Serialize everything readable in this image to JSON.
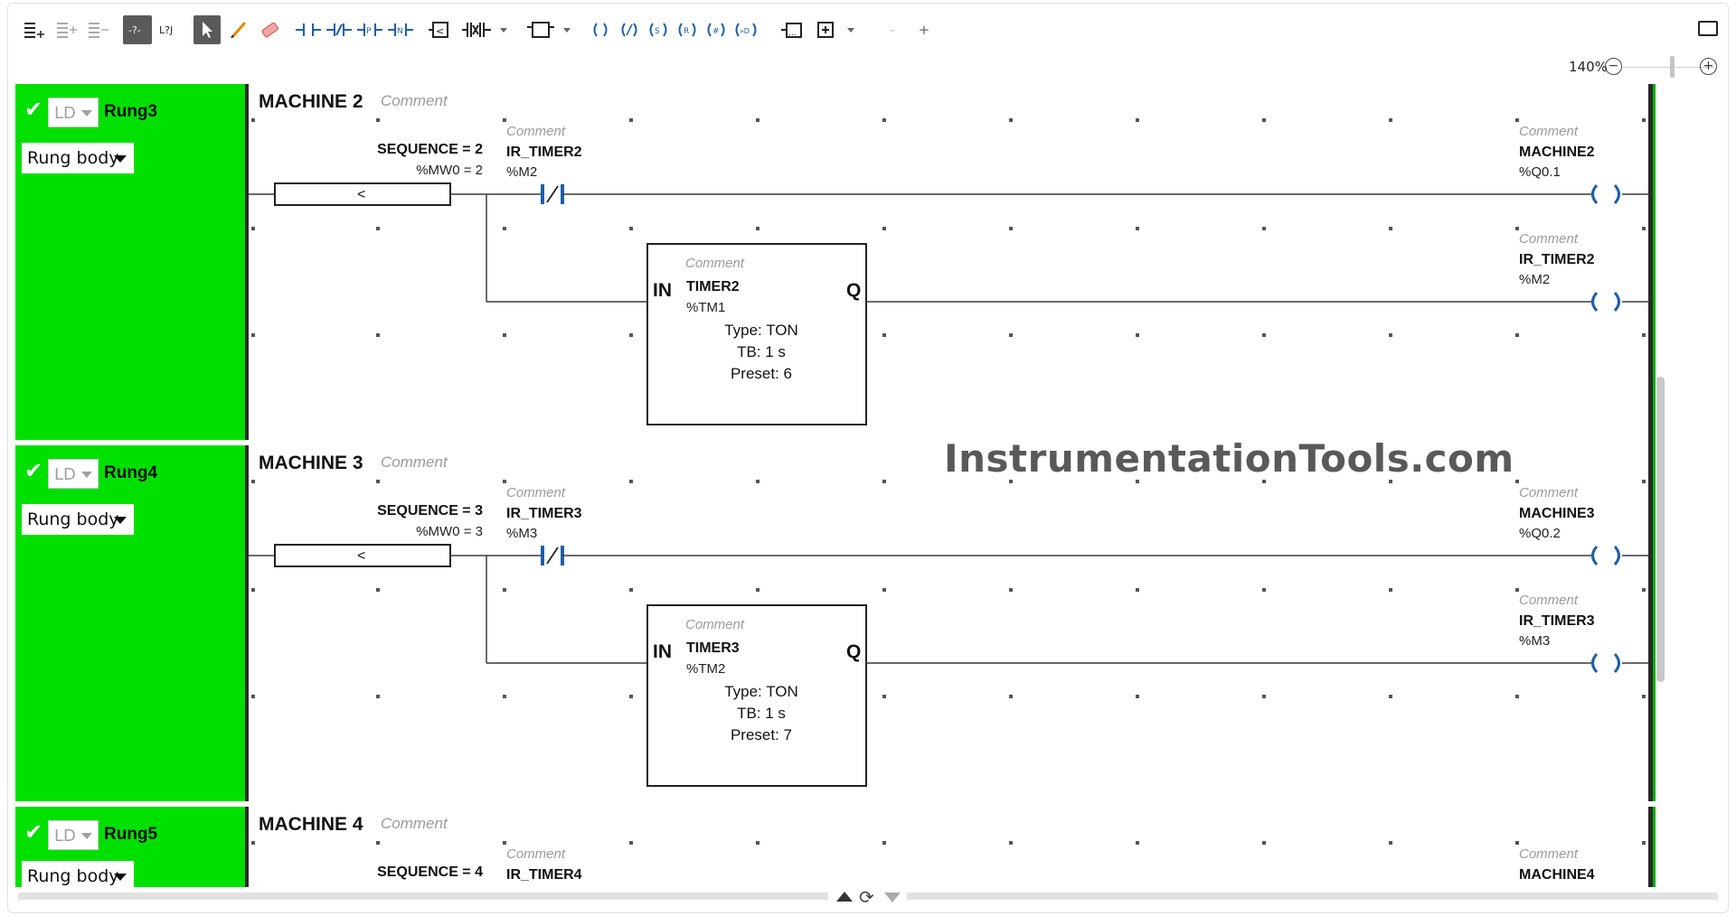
{
  "toolbar": {
    "zoom_label": "140%",
    "zoom_out_label": "−",
    "zoom_in_label": "+",
    "zoom_level": 0.52,
    "icons": [
      "add-rung-icon",
      "insert-rung-icon",
      "delete-rung-icon",
      "comment-toggle-icon",
      "jump-label-icon",
      "select-pointer-icon",
      "pencil-icon",
      "eraser-icon",
      "contact-no-icon",
      "contact-nc-icon",
      "contact-p-icon",
      "contact-n-icon",
      "compare-block-icon",
      "function-block-dropdown-icon",
      "box-dropdown-icon",
      "coil-icon",
      "negated-coil-icon",
      "set-coil-icon",
      "reset-coil-icon",
      "hash-coil-icon",
      "jump-coil-icon",
      "operation-block-icon",
      "add-branch-dropdown-icon",
      "minus-icon",
      "plus-icon",
      "fullscreen-icon"
    ]
  },
  "watermark": "InstrumentationTools.com",
  "colors": {
    "rung_bg": "#00e000",
    "wire": "#3a3a3a",
    "contact": "#1f5fa8",
    "rail": "#2a2a2a"
  },
  "rungs": [
    {
      "name": "Rung3",
      "lang": "LD",
      "section": "Rung body",
      "title": "MACHINE 2",
      "title_comment": "Comment",
      "compare_label": "SEQUENCE = 2",
      "compare_addr": "%MW0 = 2",
      "compare_op": "<",
      "contact_comment": "Comment",
      "contact_name": "IR_TIMER2",
      "contact_addr": "%M2",
      "coil1_comment": "Comment",
      "coil1_name": "MACHINE2",
      "coil1_addr": "%Q0.1",
      "coil2_comment": "Comment",
      "coil2_name": "IR_TIMER2",
      "coil2_addr": "%M2",
      "timer": {
        "comment": "Comment",
        "name": "TIMER2",
        "addr": "%TM1",
        "in": "IN",
        "q": "Q",
        "type": "Type:  TON",
        "tb": "TB:  1 s",
        "preset": "Preset:  6"
      }
    },
    {
      "name": "Rung4",
      "lang": "LD",
      "section": "Rung body",
      "title": "MACHINE 3",
      "title_comment": "Comment",
      "compare_label": "SEQUENCE = 3",
      "compare_addr": "%MW0 = 3",
      "compare_op": "<",
      "contact_comment": "Comment",
      "contact_name": "IR_TIMER3",
      "contact_addr": "%M3",
      "coil1_comment": "Comment",
      "coil1_name": "MACHINE3",
      "coil1_addr": "%Q0.2",
      "coil2_comment": "Comment",
      "coil2_name": "IR_TIMER3",
      "coil2_addr": "%M3",
      "timer": {
        "comment": "Comment",
        "name": "TIMER3",
        "addr": "%TM2",
        "in": "IN",
        "q": "Q",
        "type": "Type:  TON",
        "tb": "TB:  1 s",
        "preset": "Preset:  7"
      }
    },
    {
      "name": "Rung5",
      "lang": "LD",
      "section": "Rung body",
      "title": "MACHINE 4",
      "title_comment": "Comment",
      "compare_label": "SEQUENCE = 4",
      "contact_comment": "Comment",
      "contact_name": "IR_TIMER4",
      "coil1_comment": "Comment",
      "coil1_name": "MACHINE4"
    }
  ]
}
